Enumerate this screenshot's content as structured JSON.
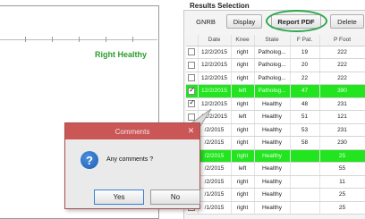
{
  "plot": {
    "series_label": "Right Healthy"
  },
  "results": {
    "title": "Results Selection",
    "buttons": {
      "gnrb": "GNRB",
      "display": "Display",
      "report_pdf": "Report PDF",
      "delete": "Delete"
    },
    "columns": [
      "",
      "Date",
      "Knee",
      "State",
      "F Pat.",
      "P Foot"
    ],
    "rows": [
      {
        "checked": false,
        "highlight": false,
        "date": "12/2/2015",
        "knee": "right",
        "state": "Patholog...",
        "fpat": "19",
        "pfoot": "222"
      },
      {
        "checked": false,
        "highlight": false,
        "date": "12/2/2015",
        "knee": "right",
        "state": "Patholog...",
        "fpat": "20",
        "pfoot": "222"
      },
      {
        "checked": false,
        "highlight": false,
        "date": "12/2/2015",
        "knee": "right",
        "state": "Patholog...",
        "fpat": "22",
        "pfoot": "222"
      },
      {
        "checked": true,
        "highlight": true,
        "date": "12/2/2015",
        "knee": "left",
        "state": "Patholog...",
        "fpat": "47",
        "pfoot": "390"
      },
      {
        "checked": true,
        "highlight": false,
        "date": "12/2/2015",
        "knee": "right",
        "state": "Healthy",
        "fpat": "48",
        "pfoot": "231"
      },
      {
        "checked": false,
        "highlight": false,
        "date": "12/2/2015",
        "knee": "left",
        "state": "Healthy",
        "fpat": "51",
        "pfoot": "121"
      },
      {
        "checked": false,
        "highlight": false,
        "date": "/2/2015",
        "knee": "right",
        "state": "Healthy",
        "fpat": "53",
        "pfoot": "231"
      },
      {
        "checked": false,
        "highlight": false,
        "date": "/2/2015",
        "knee": "right",
        "state": "Healthy",
        "fpat": "58",
        "pfoot": "230"
      },
      {
        "checked": false,
        "highlight": true,
        "date": "/2/2015",
        "knee": "right",
        "state": "Healthy",
        "fpat": "",
        "pfoot": "25"
      },
      {
        "checked": false,
        "highlight": false,
        "date": "/2/2015",
        "knee": "left",
        "state": "Healthy",
        "fpat": "",
        "pfoot": "55"
      },
      {
        "checked": false,
        "highlight": false,
        "date": "/2/2015",
        "knee": "right",
        "state": "Healthy",
        "fpat": "",
        "pfoot": "11"
      },
      {
        "checked": false,
        "highlight": false,
        "date": "/1/2015",
        "knee": "right",
        "state": "Healthy",
        "fpat": "",
        "pfoot": "25"
      },
      {
        "checked": false,
        "highlight": false,
        "date": "/1/2015",
        "knee": "right",
        "state": "Healthy",
        "fpat": "",
        "pfoot": "25"
      }
    ]
  },
  "dialog": {
    "title": "Comments",
    "close_glyph": "✕",
    "icon_glyph": "?",
    "message": "Any comments ?",
    "yes_label": "Yes",
    "no_label": "No"
  },
  "colors": {
    "highlight_row": "#22e51f",
    "annotation_ring": "#2fa84f",
    "dialog_title_bar": "#ca5656",
    "plot_label": "#2a9d2a"
  },
  "icons": {
    "dialog_icon": "question-icon",
    "dialog_close": "close-icon"
  }
}
